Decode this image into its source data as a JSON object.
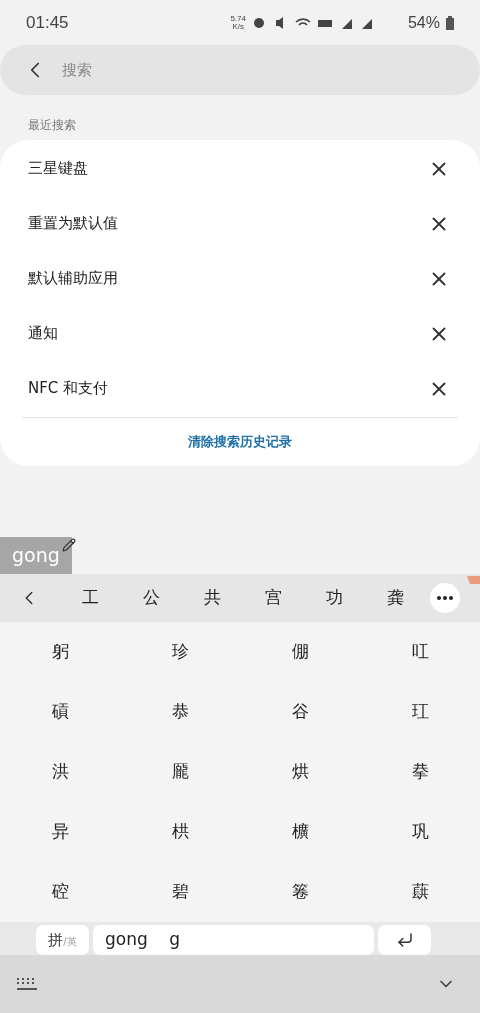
{
  "status_bar": {
    "time": "01:45",
    "speed": "5.74",
    "speed_unit": "K/s",
    "battery": "54%"
  },
  "search": {
    "placeholder": "搜索"
  },
  "recent": {
    "title": "最近搜索",
    "items": [
      {
        "label": "三星键盘"
      },
      {
        "label": "重置为默认值"
      },
      {
        "label": "默认辅助应用"
      },
      {
        "label": "通知"
      },
      {
        "label": "NFC 和支付"
      }
    ],
    "clear": "清除搜索历史记录"
  },
  "keyboard": {
    "composition": "gong",
    "candidates": [
      "工",
      "公",
      "共",
      "宫",
      "功",
      "龚"
    ],
    "grid": [
      "躬",
      "珍",
      "倗",
      "叿",
      "碽",
      "恭",
      "谷",
      "玒",
      "洪",
      "龎",
      "烘",
      "拲",
      "异",
      "栱",
      "櫎",
      "巩",
      "硿",
      "碧",
      "箞",
      "蕻"
    ],
    "mode_main": "拼",
    "mode_alt": "/英",
    "input": "gong    g"
  }
}
